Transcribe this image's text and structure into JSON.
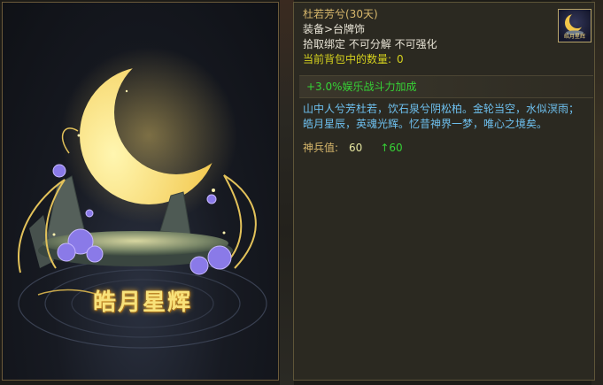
{
  "artwork": {
    "title": "皓月星辉"
  },
  "item": {
    "name": "杜若芳兮(30天)",
    "category": "装备>台牌饰",
    "binding": "拾取绑定 不可分解 不可强化",
    "bag_count_label": "当前背包中的数量:",
    "bag_count_value": "0",
    "bonus": "+3.0%娱乐战斗力加成",
    "description": "山中人兮芳杜若，饮石泉兮阴松柏。金轮当空，水似溟雨；皓月星辰，英魂光辉。忆昔神界一梦，唯心之境矣。",
    "stat_label": "神兵值:",
    "stat_value": "60",
    "stat_increase": "↑60",
    "icon": "crescent-moon-icon",
    "icon_caption": "皓月星辉"
  },
  "colors": {
    "name": "#d8b86c",
    "count": "#d6d21e",
    "bonus": "#36d236",
    "description": "#6ec0ef",
    "panel_border": "#5e5538"
  }
}
